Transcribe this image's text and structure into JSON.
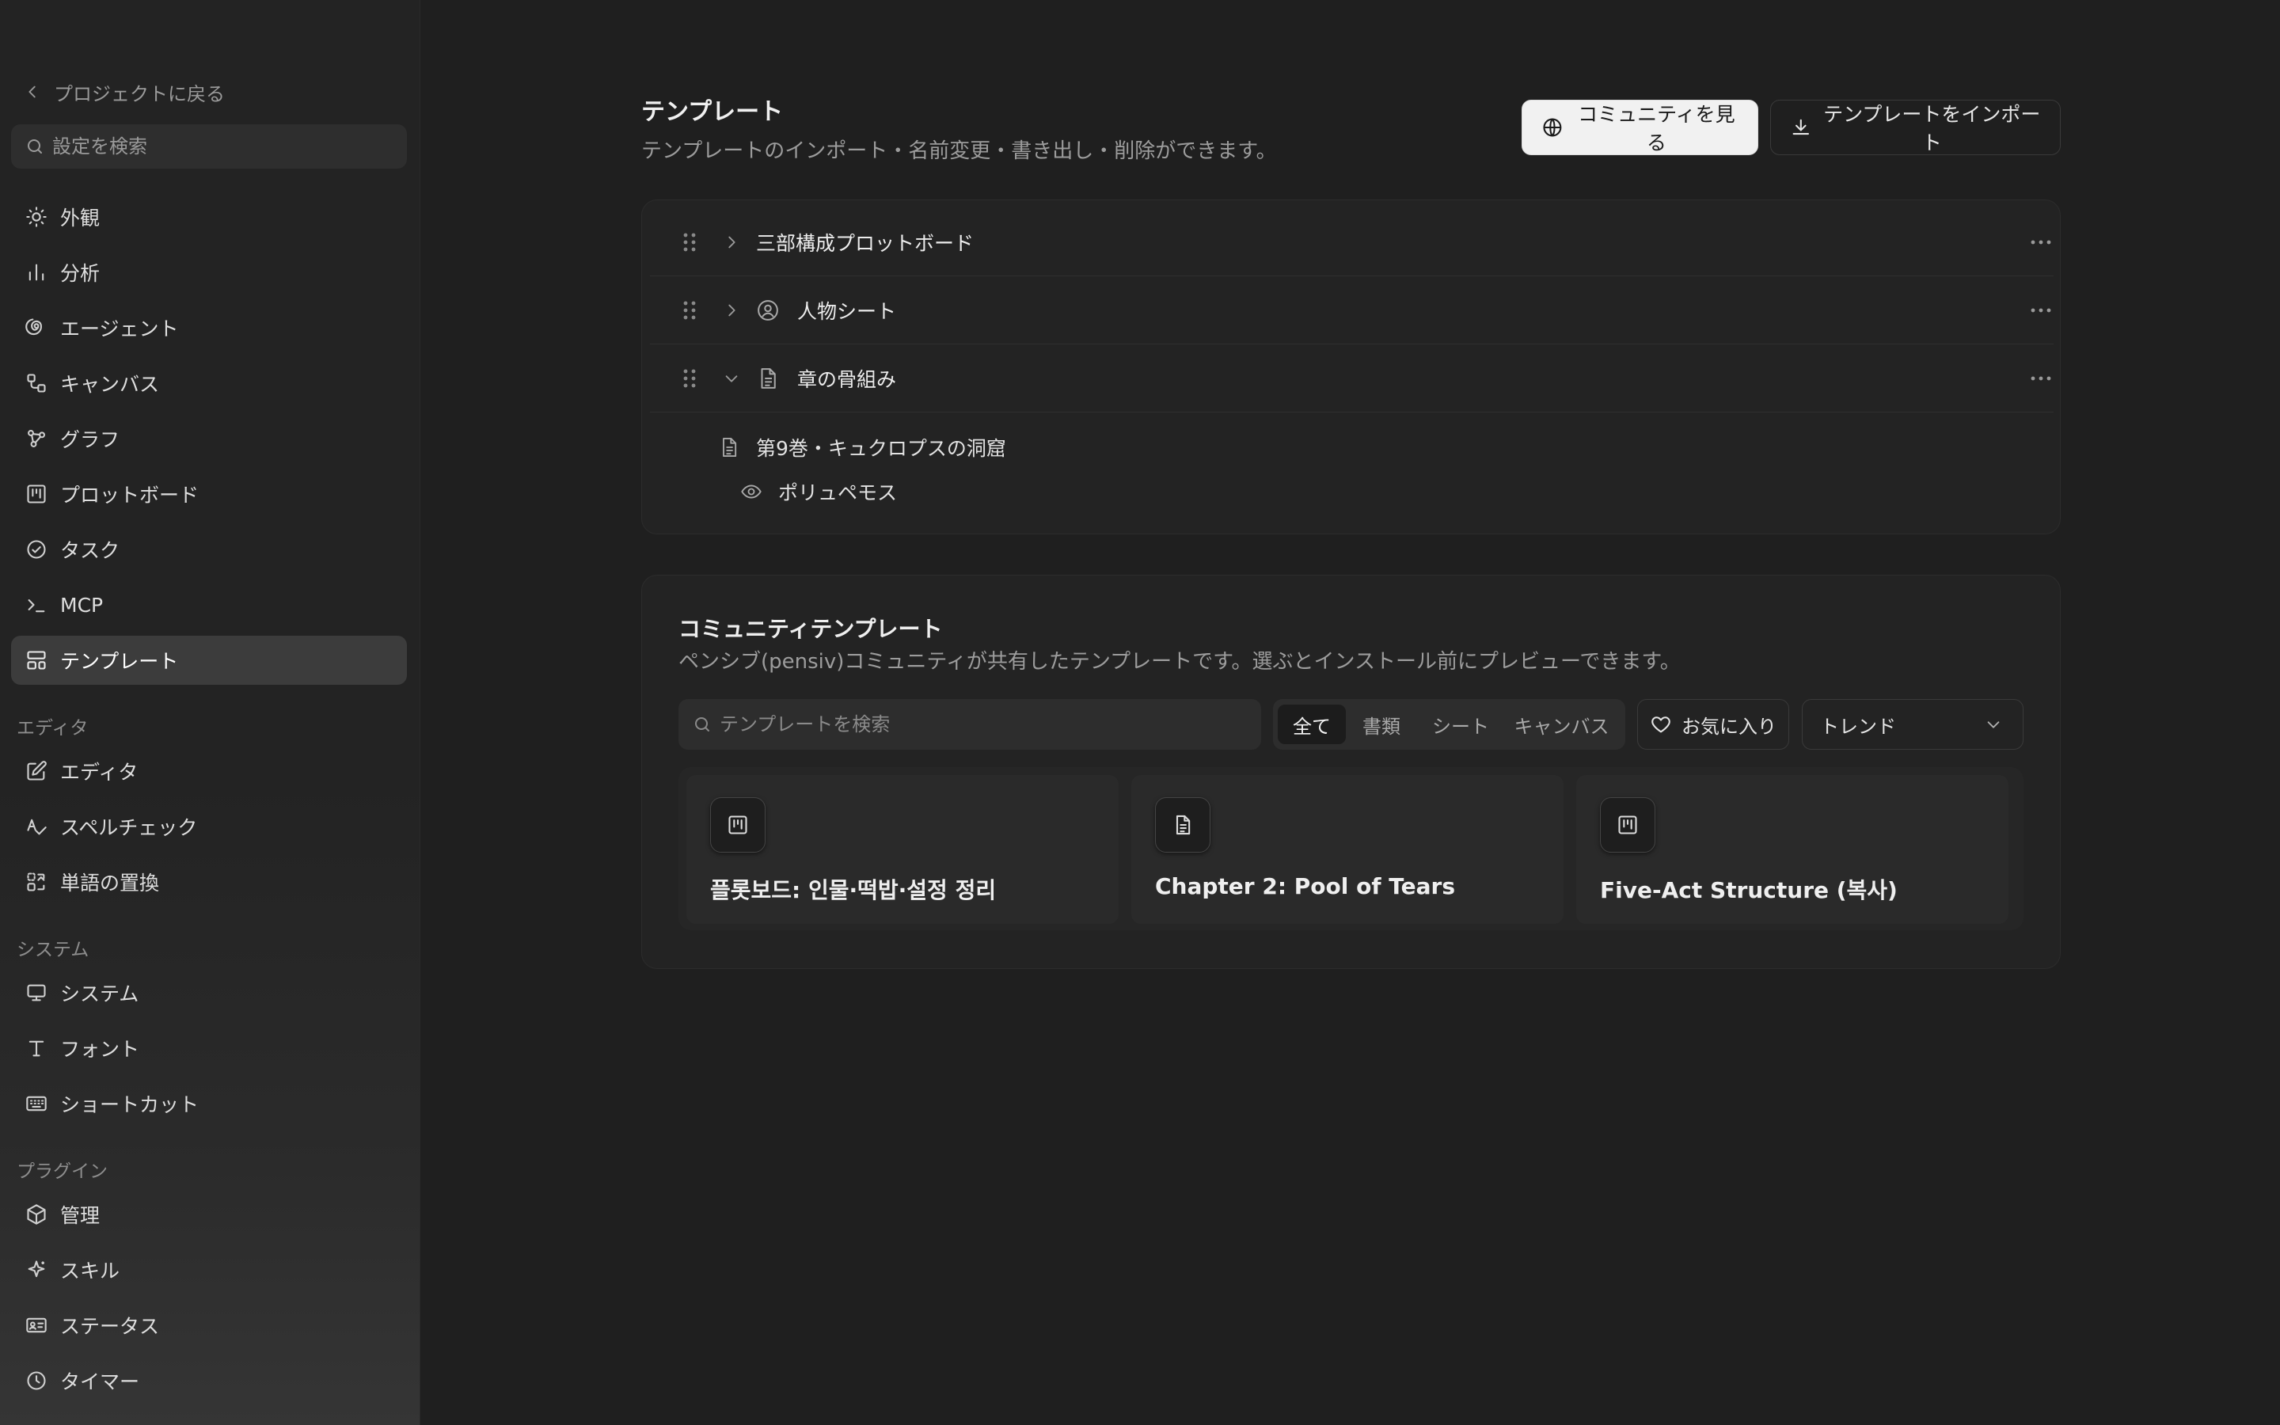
{
  "sidebar": {
    "back_label": "プロジェクトに戻る",
    "search_placeholder": "設定を検索",
    "items": {
      "appearance": "外観",
      "analytics": "分析",
      "agent": "エージェント",
      "canvas": "キャンバス",
      "graph": "グラフ",
      "plotboard": "プロットボード",
      "tasks": "タスク",
      "mcp": "MCP",
      "templates": "テンプレート"
    },
    "section_editor": "エディタ",
    "editor_items": {
      "editor": "エディタ",
      "spellcheck": "スペルチェック",
      "replace": "単語の置換"
    },
    "section_system": "システム",
    "system_items": {
      "system": "システム",
      "fonts": "フォント",
      "shortcuts": "ショートカット"
    },
    "section_plugins": "プラグイン",
    "plugin_items": {
      "manage": "管理",
      "skills": "スキル",
      "status": "ステータス",
      "timer": "タイマー"
    },
    "active_item": "templates"
  },
  "header": {
    "title": "テンプレート",
    "subtitle": "テンプレートのインポート・名前変更・書き出し・削除ができます。",
    "community_button": "コミュニティを見る",
    "import_button": "テンプレートをインポート"
  },
  "templates": [
    {
      "label": "三部構成プロットボード",
      "expanded": false,
      "icon": "none"
    },
    {
      "label": "人物シート",
      "expanded": false,
      "icon": "user-circle-icon"
    },
    {
      "label": "章の骨組み",
      "expanded": true,
      "icon": "document-icon"
    }
  ],
  "template_children": {
    "document": "第9巻・キュクロプスの洞窟",
    "character": "ポリュペモス"
  },
  "community": {
    "title": "コミュニティテンプレート",
    "description": "ペンシブ(pensiv)コミュニティが共有したテンプレートです。選ぶとインストール前にプレビューできます。",
    "search_placeholder": "テンプレートを検索",
    "filters": [
      "全て",
      "書類",
      "シート",
      "キャンバス"
    ],
    "active_filter": "全て",
    "favorites_label": "お気に入り",
    "sort_value": "トレンド",
    "cards": [
      {
        "title": "플롯보드: 인물·떡밥·설정 정리",
        "icon": "kanban-icon"
      },
      {
        "title": "Chapter 2: Pool of Tears",
        "icon": "document-icon"
      },
      {
        "title": "Five-Act Structure (복사)",
        "icon": "kanban-icon"
      }
    ]
  }
}
